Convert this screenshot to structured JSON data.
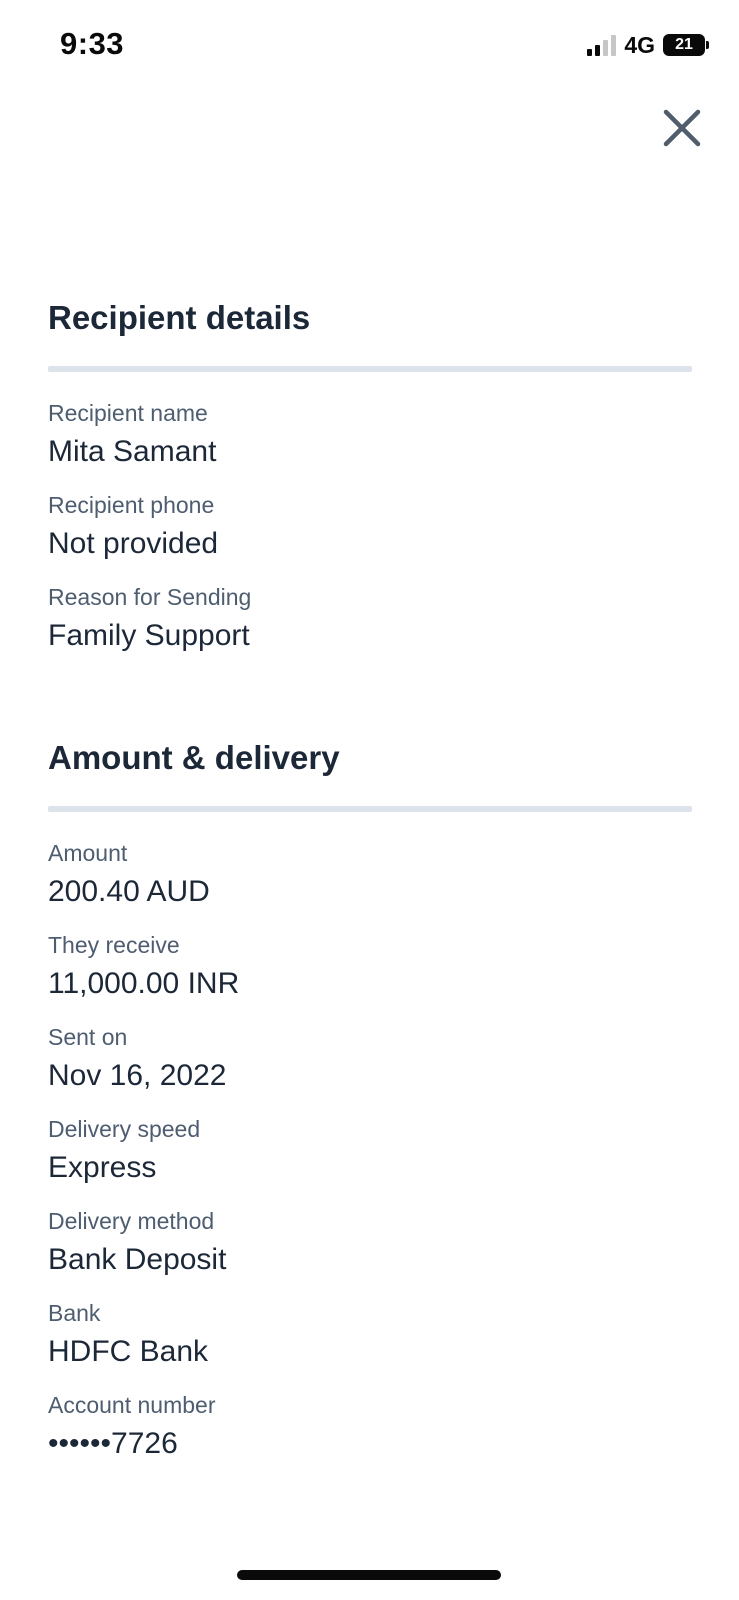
{
  "status_bar": {
    "time": "9:33",
    "network": "4G",
    "battery": "21",
    "signal_bars_active": 2,
    "signal_bars_total": 4
  },
  "icons": {
    "close": "close-icon"
  },
  "recipient_section": {
    "title": "Recipient details",
    "fields": [
      {
        "label": "Recipient name",
        "value": "Mita Samant"
      },
      {
        "label": "Recipient phone",
        "value": "Not provided"
      },
      {
        "label": "Reason for Sending",
        "value": "Family Support"
      }
    ]
  },
  "amount_section": {
    "title": "Amount & delivery",
    "fields": [
      {
        "label": "Amount",
        "value": "200.40 AUD"
      },
      {
        "label": "They receive",
        "value": "11,000.00 INR"
      },
      {
        "label": "Sent on",
        "value": "Nov 16, 2022"
      },
      {
        "label": "Delivery speed",
        "value": "Express"
      },
      {
        "label": "Delivery method",
        "value": "Bank Deposit"
      },
      {
        "label": "Bank",
        "value": "HDFC Bank"
      },
      {
        "label": "Account number",
        "value": "••••••7726"
      }
    ]
  },
  "colors": {
    "heading": "#1c2838",
    "label": "#4e5d70",
    "divider": "#dde3ea",
    "close_icon": "#4f5d6c"
  }
}
